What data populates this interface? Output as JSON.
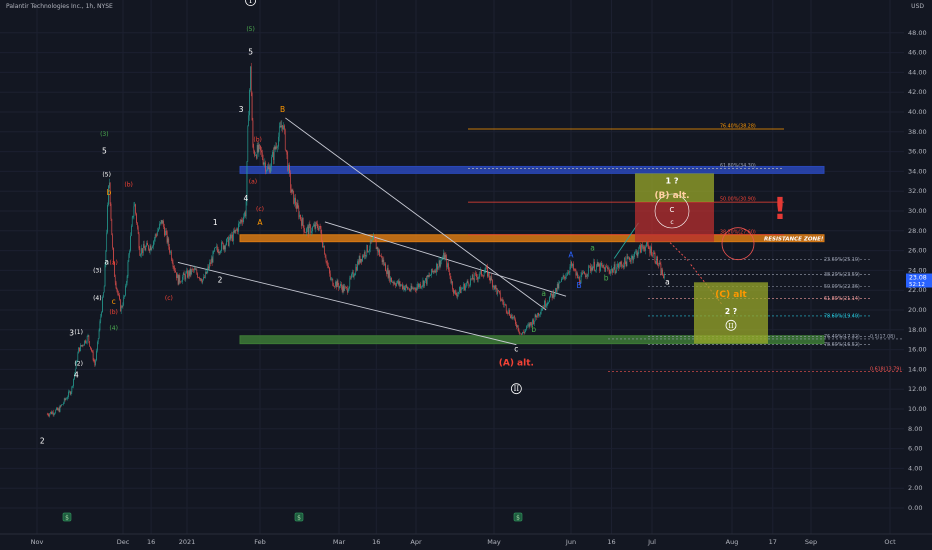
{
  "header": {
    "title": "Palantir Technologies Inc., 1h, NYSE",
    "currency": "USD"
  },
  "price_label": {
    "value": "23.08",
    "countdown": "52:12"
  },
  "colors": {
    "bg": "#131722",
    "candle_up": "#26a69a",
    "candle_down": "#ef5350",
    "blue_zone": "#2a48b8",
    "orange_zone": "#d97a14",
    "green_zone": "#3d7a36",
    "red_box": "#b82f2f",
    "yellow_box": "#9aa82a",
    "wave_white": "#ffffff",
    "wave_green": "#4caf50",
    "wave_orange": "#ff9800",
    "wave_red": "#f44336",
    "wave_blue": "#2962ff"
  },
  "chart_data": {
    "type": "candlestick",
    "title": "Palantir Technologies Inc., 1h, NYSE",
    "y_ticks": [
      "48.00",
      "46.00",
      "44.00",
      "42.00",
      "40.00",
      "38.00",
      "36.00",
      "34.00",
      "32.00",
      "30.00",
      "28.00",
      "26.00",
      "24.00",
      "22.00",
      "20.00",
      "18.00",
      "16.00",
      "14.00",
      "12.00",
      "10.00",
      "8.00",
      "6.00",
      "4.00",
      "2.00",
      "0.00"
    ],
    "x_ticks": [
      "Nov",
      "Dec",
      "16",
      "2021",
      "Feb",
      "Mar",
      "16",
      "Apr",
      "May",
      "Jun",
      "16",
      "Jul",
      "Aug",
      "17",
      "Sep",
      "Oct"
    ],
    "ylim": [
      -1,
      50
    ],
    "price_path": [
      {
        "x": "Oct 26",
        "y": 9.5
      },
      {
        "x": "Nov 2",
        "y": 9.9
      },
      {
        "x": "Nov 9",
        "y": 12.0
      },
      {
        "x": "Nov 12",
        "y": 16.0
      },
      {
        "x": "Nov 16",
        "y": 17.3
      },
      {
        "x": "Nov 19",
        "y": 14.4
      },
      {
        "x": "Nov 23",
        "y": 22.5
      },
      {
        "x": "Nov 25",
        "y": 33.5
      },
      {
        "x": "Nov 27",
        "y": 24.0
      },
      {
        "x": "Nov 30",
        "y": 20.0
      },
      {
        "x": "Dec 2",
        "y": 21.5
      },
      {
        "x": "Dec 7",
        "y": 31.0
      },
      {
        "x": "Dec 10",
        "y": 26.0
      },
      {
        "x": "Dec 16",
        "y": 26.5
      },
      {
        "x": "Dec 21",
        "y": 29.0
      },
      {
        "x": "Dec 28",
        "y": 23.0
      },
      {
        "x": "Jan 4",
        "y": 24.0
      },
      {
        "x": "Jan 8",
        "y": 23.0
      },
      {
        "x": "Jan 13",
        "y": 26.0
      },
      {
        "x": "Jan 18",
        "y": 26.8
      },
      {
        "x": "Jan 21",
        "y": 27.6
      },
      {
        "x": "Jan 26",
        "y": 30.0
      },
      {
        "x": "Jan 27",
        "y": 39.5
      },
      {
        "x": "Jan 28",
        "y": 44.6
      },
      {
        "x": "Jan 29",
        "y": 36.0
      },
      {
        "x": "Feb 1",
        "y": 36.0
      },
      {
        "x": "Feb 4",
        "y": 34.0
      },
      {
        "x": "Feb 9",
        "y": 39.0
      },
      {
        "x": "Feb 12",
        "y": 32.0
      },
      {
        "x": "Feb 17",
        "y": 28.0
      },
      {
        "x": "Feb 22",
        "y": 28.5
      },
      {
        "x": "Feb 26",
        "y": 23.0
      },
      {
        "x": "Mar 4",
        "y": 22.0
      },
      {
        "x": "Mar 9",
        "y": 25.0
      },
      {
        "x": "Mar 15",
        "y": 27.0
      },
      {
        "x": "Mar 22",
        "y": 23.0
      },
      {
        "x": "Mar 30",
        "y": 22.0
      },
      {
        "x": "Apr 5",
        "y": 23.0
      },
      {
        "x": "Apr 12",
        "y": 25.5
      },
      {
        "x": "Apr 16",
        "y": 21.5
      },
      {
        "x": "Apr 22",
        "y": 23.0
      },
      {
        "x": "Apr 28",
        "y": 24.0
      },
      {
        "x": "May 4",
        "y": 21.0
      },
      {
        "x": "May 10",
        "y": 18.6
      },
      {
        "x": "May 12",
        "y": 17.5
      },
      {
        "x": "May 17",
        "y": 19.0
      },
      {
        "x": "May 21",
        "y": 20.5
      },
      {
        "x": "May 26",
        "y": 22.0
      },
      {
        "x": "Jun 1",
        "y": 24.5
      },
      {
        "x": "Jun 4",
        "y": 23.0
      },
      {
        "x": "Jun 9",
        "y": 24.5
      },
      {
        "x": "Jun 16",
        "y": 24.0
      },
      {
        "x": "Jun 22",
        "y": 25.0
      },
      {
        "x": "Jun 28",
        "y": 26.5
      },
      {
        "x": "Jul 1",
        "y": 26.0
      },
      {
        "x": "Jul 6",
        "y": 23.08
      }
    ],
    "zones": [
      {
        "name": "blue",
        "from": 33.8,
        "to": 34.5
      },
      {
        "name": "resistance",
        "label": "RESISTANCE ZONE!",
        "from": 26.9,
        "to": 27.6
      },
      {
        "name": "support",
        "from": 16.6,
        "to": 17.4
      }
    ],
    "fib_upper": [
      {
        "label": "76.40%(38.28)",
        "y": 38.28,
        "color": "#ff9800"
      },
      {
        "label": "61.80%(34.30)",
        "y": 34.3,
        "color": "#9aa0b0"
      },
      {
        "label": "50.00%(30.90)",
        "y": 30.9,
        "color": "#f44336"
      },
      {
        "label": "38.20%(27.60)",
        "y": 27.6,
        "color": "#f44336"
      }
    ],
    "fib_lower": [
      {
        "label": "23.60%(25.10)",
        "y": 25.1,
        "color": "#9aa0b0"
      },
      {
        "label": "38.20%(23.59)",
        "y": 23.59,
        "color": "#9aa0b0"
      },
      {
        "label": "50.00%(22.36)",
        "y": 22.36,
        "color": "#9aa0b0"
      },
      {
        "label": "61.80%(21.14)",
        "y": 21.14,
        "color": "#ef9a9a"
      },
      {
        "label": "78.60%(19.40)",
        "y": 19.4,
        "color": "#26c6da"
      },
      {
        "label": "76.40%(17.32)",
        "y": 17.32,
        "color": "#9aa0b0"
      },
      {
        "label": "78.60%(16.52)",
        "y": 16.52,
        "color": "#9aa0b0"
      }
    ],
    "fib_extra": [
      {
        "label": "0.5(17.08)",
        "y": 17.08,
        "color": "#9aa0b0"
      },
      {
        "label": "0.618(13.79)",
        "y": 13.79,
        "color": "#ef5350"
      }
    ],
    "boxes": [
      {
        "name": "red-target-box",
        "label1": "1 ?",
        "label2": "(B) alt.",
        "label3": "C",
        "label4": "c",
        "from": 26.9,
        "to": 33.8
      },
      {
        "name": "yellow-target-box",
        "label1": "(C) alt",
        "label2": "2 ?",
        "label3": "II",
        "from": 16.6,
        "to": 22.8
      }
    ],
    "wave_labels": [
      {
        "text": "2",
        "x": "Oct 23",
        "y": 6.5,
        "color": "white"
      },
      {
        "text": "3",
        "x": "Nov 9",
        "y": 17.4,
        "color": "white"
      },
      {
        "text": "4",
        "x": "Nov 11",
        "y": 13.2,
        "color": "white"
      },
      {
        "text": "(1)",
        "x": "Nov 12",
        "y": 17.6,
        "color": "white"
      },
      {
        "text": "(2)",
        "x": "Nov 12",
        "y": 14.4,
        "color": "white"
      },
      {
        "text": "(3)",
        "x": "Nov 20",
        "y": 23.8,
        "color": "white"
      },
      {
        "text": "(4)",
        "x": "Nov 20",
        "y": 21.0,
        "color": "white"
      },
      {
        "text": "(5)",
        "x": "Nov 24",
        "y": 33.5,
        "color": "white"
      },
      {
        "text": "a",
        "x": "Nov 24",
        "y": 24.6,
        "color": "white"
      },
      {
        "text": "b",
        "x": "Nov 25",
        "y": 31.6,
        "color": "orange"
      },
      {
        "text": "c",
        "x": "Nov 27",
        "y": 20.6,
        "color": "orange"
      },
      {
        "text": "(b)",
        "x": "Dec 4",
        "y": 32.5,
        "color": "red"
      },
      {
        "text": "(c)",
        "x": "Dec 24",
        "y": 21.0,
        "color": "red"
      },
      {
        "text": "(a)",
        "x": "Nov 27",
        "y": 24.6,
        "color": "red"
      },
      {
        "text": "(b)",
        "x": "Nov 27",
        "y": 19.6,
        "color": "red"
      },
      {
        "text": "(4)",
        "x": "Nov 27",
        "y": 18.0,
        "color": "green"
      },
      {
        "text": "(3)",
        "x": "Nov 23",
        "y": 37.6,
        "color": "green"
      },
      {
        "text": "5",
        "x": "Nov 23",
        "y": 35.8,
        "color": "white"
      },
      {
        "text": "1",
        "x": "Jan 13",
        "y": 28.6,
        "color": "white"
      },
      {
        "text": "2",
        "x": "Jan 15",
        "y": 22.8,
        "color": "white"
      },
      {
        "text": "3",
        "x": "Jan 24",
        "y": 40.0,
        "color": "white"
      },
      {
        "text": "4",
        "x": "Jan 26",
        "y": 31.0,
        "color": "white"
      },
      {
        "text": "5",
        "x": "Jan 28",
        "y": 45.8,
        "color": "white"
      },
      {
        "text": "(5)",
        "x": "Jan 28",
        "y": 48.2,
        "color": "green"
      },
      {
        "text": "I",
        "x": "Jan 28",
        "y": 51.0,
        "color": "circle"
      },
      {
        "text": "(b)",
        "x": "Jan 31",
        "y": 37.0,
        "color": "red"
      },
      {
        "text": "(a)",
        "x": "Jan 29",
        "y": 32.8,
        "color": "red"
      },
      {
        "text": "(c)",
        "x": "Feb 1",
        "y": 30.0,
        "color": "red"
      },
      {
        "text": "A",
        "x": "Feb 1",
        "y": 28.6,
        "color": "orange"
      },
      {
        "text": "B",
        "x": "Feb 9",
        "y": 40.0,
        "color": "orange"
      },
      {
        "text": "a",
        "x": "May 21",
        "y": 21.4,
        "color": "green"
      },
      {
        "text": "b",
        "x": "May 17",
        "y": 17.8,
        "color": "green"
      },
      {
        "text": "c",
        "x": "May 10",
        "y": 15.8,
        "color": "white"
      },
      {
        "text": "(A) alt.",
        "x": "May 10",
        "y": 14.4,
        "color": "red"
      },
      {
        "text": "II",
        "x": "May 10",
        "y": 11.8,
        "color": "circle"
      },
      {
        "text": "A",
        "x": "Jun 1",
        "y": 25.3,
        "color": "blue"
      },
      {
        "text": "B",
        "x": "Jun 4",
        "y": 22.2,
        "color": "blue"
      },
      {
        "text": "a",
        "x": "Jun 9",
        "y": 26.0,
        "color": "green"
      },
      {
        "text": "b",
        "x": "Jun 14",
        "y": 23.0,
        "color": "green"
      },
      {
        "text": "a",
        "x": "Jul 7",
        "y": 22.6,
        "color": "white"
      }
    ],
    "alert_mark": "!"
  }
}
